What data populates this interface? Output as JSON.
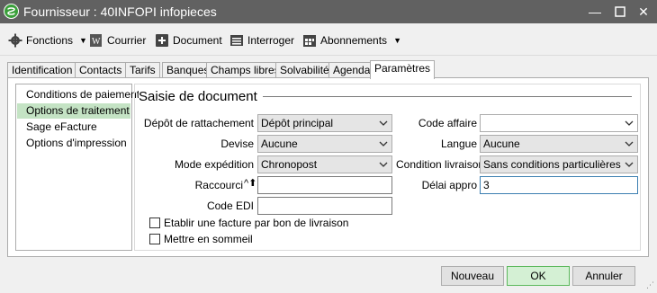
{
  "window": {
    "title": "Fournisseur : 40INFOPI infopieces"
  },
  "toolbar": {
    "fonctions": "Fonctions",
    "courrier": "Courrier",
    "document": "Document",
    "interroger": "Interroger",
    "abonnements": "Abonnements"
  },
  "tabs": [
    "Identification",
    "Contacts",
    "Tarifs",
    "Banques",
    "Champs libres",
    "Solvabilité",
    "Agenda",
    "Paramètres"
  ],
  "sidebar": {
    "items": [
      "Conditions de paiement",
      "Options de traitement",
      "Sage eFacture",
      "Options d'impression"
    ]
  },
  "section": {
    "title": "Saisie de document"
  },
  "form": {
    "depot_label": "Dépôt de rattachement",
    "depot_value": "Dépôt principal",
    "devise_label": "Devise",
    "devise_value": "Aucune",
    "mode_label": "Mode expédition",
    "mode_value": "Chronopost",
    "raccourci_label": "Raccourci",
    "raccourci_value": "",
    "code_edi_label": "Code EDI",
    "code_edi_value": "",
    "code_affaire_label": "Code affaire",
    "code_affaire_value": "",
    "langue_label": "Langue",
    "langue_value": "Aucune",
    "condition_label": "Condition livraison",
    "condition_value": "Sans conditions particulières",
    "delai_label": "Délai appro",
    "delai_value": "3",
    "check_facture": "Etablir une facture par bon de livraison",
    "check_sommeil": "Mettre en sommeil"
  },
  "buttons": {
    "nouveau": "Nouveau",
    "ok": "OK",
    "annuler": "Annuler"
  },
  "colors": {
    "titlebar": "#616161",
    "selected": "#c4e3c4",
    "ok_border": "#5cb85c",
    "logo": "#3a9f3a"
  }
}
